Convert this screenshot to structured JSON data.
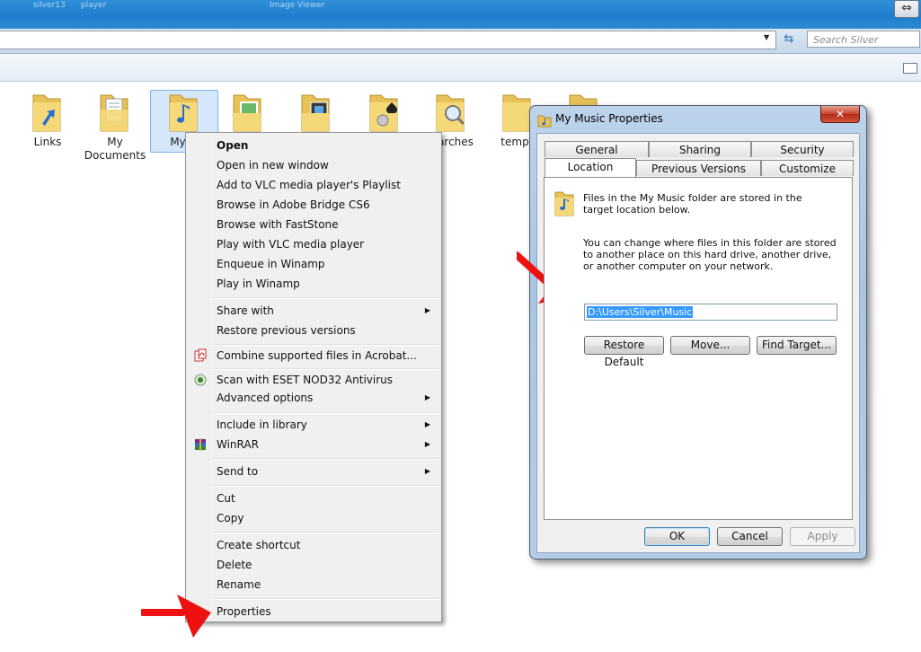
{
  "window": {
    "title_fragments": [
      "silver13",
      "player",
      "Image Viewer"
    ],
    "restore_glyph": "⇔"
  },
  "address": {
    "search_placeholder": "Search Silver"
  },
  "folders": [
    {
      "label": "Links",
      "icon": "folder-links-icon"
    },
    {
      "label": "My\nDocuments",
      "icon": "folder-documents-icon"
    },
    {
      "label": "My M",
      "icon": "folder-music-icon"
    },
    {
      "label": "",
      "icon": "folder-pictures-icon"
    },
    {
      "label": "",
      "icon": "folder-videos-icon"
    },
    {
      "label": "",
      "icon": "folder-games-icon"
    },
    {
      "label": "arches",
      "icon": "folder-searches-icon"
    },
    {
      "label": "temp",
      "icon": "folder-temp-icon"
    }
  ],
  "context_menu": {
    "items": [
      {
        "label": "Open"
      },
      {
        "label": "Open in new window"
      },
      {
        "label": "Add to VLC media player's Playlist"
      },
      {
        "label": "Browse in Adobe Bridge CS6"
      },
      {
        "label": "Browse with FastStone"
      },
      {
        "label": "Play with VLC media player"
      },
      {
        "label": "Enqueue in Winamp"
      },
      {
        "label": "Play in Winamp"
      },
      {
        "label": "Share with"
      },
      {
        "label": "Restore previous versions"
      },
      {
        "label": "Combine supported files in Acrobat..."
      },
      {
        "label": "Scan with ESET NOD32 Antivirus"
      },
      {
        "label": "Advanced options"
      },
      {
        "label": "Include in library"
      },
      {
        "label": "WinRAR"
      },
      {
        "label": "Send to"
      },
      {
        "label": "Cut"
      },
      {
        "label": "Copy"
      },
      {
        "label": "Create shortcut"
      },
      {
        "label": "Delete"
      },
      {
        "label": "Rename"
      },
      {
        "label": "Properties"
      }
    ]
  },
  "dialog": {
    "title": "My Music Properties",
    "close_glyph": "✕",
    "tabs_row1": [
      "General",
      "Sharing",
      "Security"
    ],
    "tabs_row2": [
      "Location",
      "Previous Versions",
      "Customize"
    ],
    "desc1": "Files in the My Music folder are stored in the target location below.",
    "desc2": "You can change where files in this folder are stored to another place on this hard drive, another drive, or another computer on your network.",
    "path_value": "D:\\Users\\Silver\\Music",
    "buttons": {
      "restore_default": "Restore Default",
      "move": "Move...",
      "find_target": "Find Target...",
      "ok": "OK",
      "cancel": "Cancel",
      "apply": "Apply"
    }
  },
  "colors": {
    "arrow": "#ee1111",
    "folder": "#f3d36b",
    "selection": "#3399ff"
  }
}
